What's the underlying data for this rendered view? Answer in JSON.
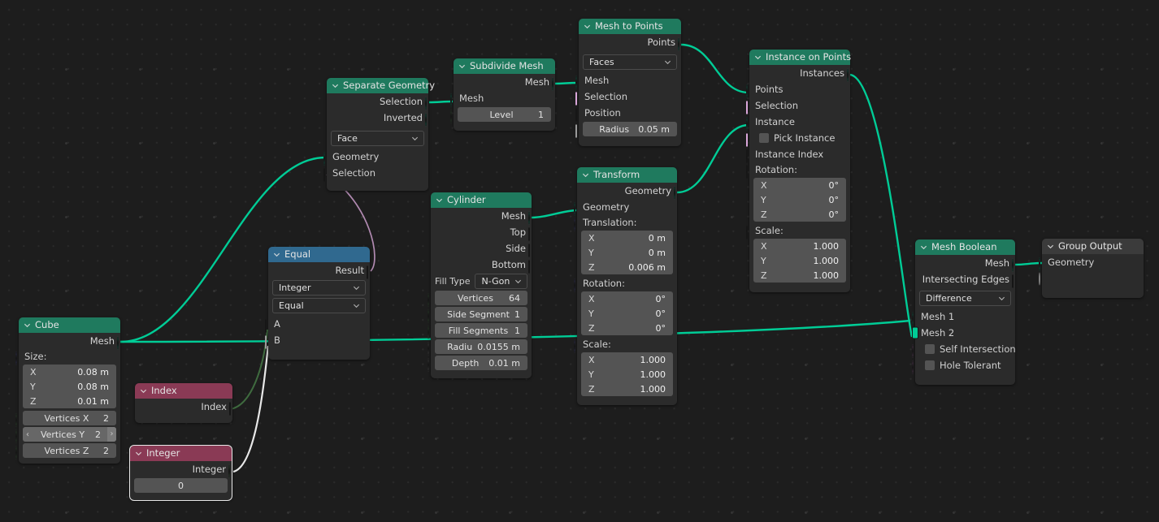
{
  "app": {
    "editor": "geometry-node-editor",
    "background": "#1d1d1d"
  },
  "colors": {
    "header_geometry": "#1f7a5e",
    "header_converter": "#30698f",
    "header_input": "#8a3a55",
    "header_output": "#3b3b3b",
    "socket_geometry": "#00cc96",
    "socket_vector": "#6363c7",
    "socket_boolean": "#cc7bcc",
    "socket_integer": "#5a9b5a",
    "wire_geometry": "#00cc96"
  },
  "nodes": {
    "cube": {
      "title": "Cube",
      "outputs": [
        "Mesh"
      ],
      "size_label": "Size:",
      "size": [
        {
          "axis": "X",
          "value": "0.08 m"
        },
        {
          "axis": "Y",
          "value": "0.08 m"
        },
        {
          "axis": "Z",
          "value": "0.01 m"
        }
      ],
      "vertices": [
        {
          "label": "Vertices X",
          "value": "2"
        },
        {
          "label": "Vertices Y",
          "value": "2"
        },
        {
          "label": "Vertices Z",
          "value": "2"
        }
      ],
      "stepper_left": "‹",
      "stepper_right": "›"
    },
    "index": {
      "title": "Index",
      "outputs": [
        "Index"
      ]
    },
    "integer": {
      "title": "Integer",
      "outputs": [
        "Integer"
      ],
      "value": "0"
    },
    "equal": {
      "title": "Equal",
      "outputs": [
        "Result"
      ],
      "data_type": "Integer",
      "operation": "Equal",
      "inputs": [
        "A",
        "B"
      ]
    },
    "separate_geometry": {
      "title": "Separate Geometry",
      "outputs": [
        "Selection",
        "Inverted"
      ],
      "domain": "Face",
      "inputs": [
        "Geometry",
        "Selection"
      ]
    },
    "subdivide_mesh": {
      "title": "Subdivide Mesh",
      "outputs": [
        "Mesh"
      ],
      "inputs": [
        "Mesh"
      ],
      "level": {
        "label": "Level",
        "value": "1"
      }
    },
    "mesh_to_points": {
      "title": "Mesh to Points",
      "outputs": [
        "Points"
      ],
      "mode": "Faces",
      "inputs": [
        "Mesh",
        "Selection",
        "Position"
      ],
      "radius": {
        "label": "Radius",
        "value": "0.05 m"
      }
    },
    "instance_on_points": {
      "title": "Instance on Points",
      "outputs": [
        "Instances"
      ],
      "inputs": [
        "Points",
        "Selection",
        "Instance"
      ],
      "pick_instance": "Pick Instance",
      "instance_index": "Instance Index",
      "rotation_label": "Rotation:",
      "rotation": [
        {
          "axis": "X",
          "value": "0°"
        },
        {
          "axis": "Y",
          "value": "0°"
        },
        {
          "axis": "Z",
          "value": "0°"
        }
      ],
      "scale_label": "Scale:",
      "scale": [
        {
          "axis": "X",
          "value": "1.000"
        },
        {
          "axis": "Y",
          "value": "1.000"
        },
        {
          "axis": "Z",
          "value": "1.000"
        }
      ]
    },
    "cylinder": {
      "title": "Cylinder",
      "outputs": [
        "Mesh",
        "Top",
        "Side",
        "Bottom"
      ],
      "fill_type_label": "Fill Type",
      "fill_type": "N-Gon",
      "params": [
        {
          "label": "Vertices",
          "value": "64"
        },
        {
          "label": "Side Segment",
          "value": "1"
        },
        {
          "label": "Fill Segments",
          "value": "1"
        },
        {
          "label": "Radiu",
          "value": "0.0155 m"
        },
        {
          "label": "Depth",
          "value": "0.01 m"
        }
      ]
    },
    "transform": {
      "title": "Transform",
      "outputs": [
        "Geometry"
      ],
      "inputs": [
        "Geometry"
      ],
      "translation_label": "Translation:",
      "translation": [
        {
          "axis": "X",
          "value": "0 m"
        },
        {
          "axis": "Y",
          "value": "0 m"
        },
        {
          "axis": "Z",
          "value": "0.006 m"
        }
      ],
      "rotation_label": "Rotation:",
      "rotation": [
        {
          "axis": "X",
          "value": "0°"
        },
        {
          "axis": "Y",
          "value": "0°"
        },
        {
          "axis": "Z",
          "value": "0°"
        }
      ],
      "scale_label": "Scale:",
      "scale": [
        {
          "axis": "X",
          "value": "1.000"
        },
        {
          "axis": "Y",
          "value": "1.000"
        },
        {
          "axis": "Z",
          "value": "1.000"
        }
      ]
    },
    "mesh_boolean": {
      "title": "Mesh Boolean",
      "outputs": [
        "Mesh",
        "Intersecting Edges"
      ],
      "operation": "Difference",
      "inputs": [
        "Mesh 1",
        "Mesh 2"
      ],
      "self_intersection": "Self Intersection",
      "hole_tolerant": "Hole Tolerant"
    },
    "group_output": {
      "title": "Group Output",
      "inputs": [
        "Geometry"
      ]
    }
  }
}
